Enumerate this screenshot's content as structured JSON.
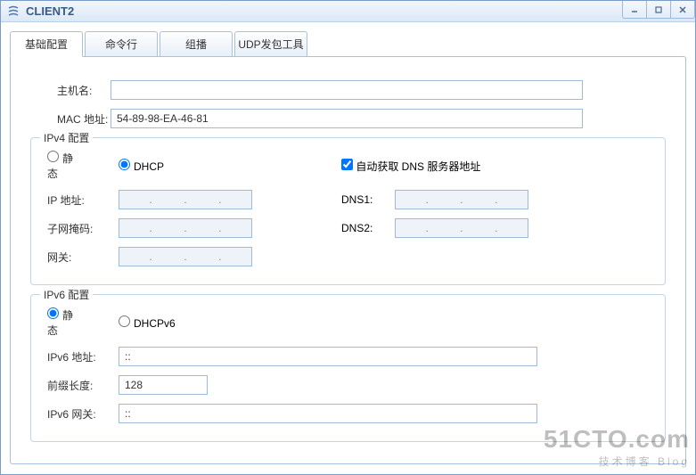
{
  "window": {
    "title": "CLIENT2"
  },
  "tabs": {
    "t0": "基础配置",
    "t1": "命令行",
    "t2": "组播",
    "t3": "UDP发包工具"
  },
  "fields": {
    "hostname_label": "主机名:",
    "hostname_value": "",
    "mac_label": "MAC 地址:",
    "mac_value": "54-89-98-EA-46-81"
  },
  "ipv4": {
    "group": "IPv4 配置",
    "static": "静态",
    "dhcp": "DHCP",
    "autodns": "自动获取 DNS 服务器地址",
    "ip_label": "IP 地址:",
    "mask_label": "子网掩码:",
    "gw_label": "网关:",
    "dns1_label": "DNS1:",
    "dns2_label": "DNS2:"
  },
  "ipv6": {
    "group": "IPv6 配置",
    "static": "静态",
    "dhcpv6": "DHCPv6",
    "addr_label": "IPv6 地址:",
    "addr_value": "::",
    "prefix_label": "前缀长度:",
    "prefix_value": "128",
    "gw_label": "IPv6 网关:",
    "gw_value": "::"
  },
  "dot": ".",
  "watermark": {
    "big": "51CTO.com",
    "small": "技术博客  Blog"
  }
}
